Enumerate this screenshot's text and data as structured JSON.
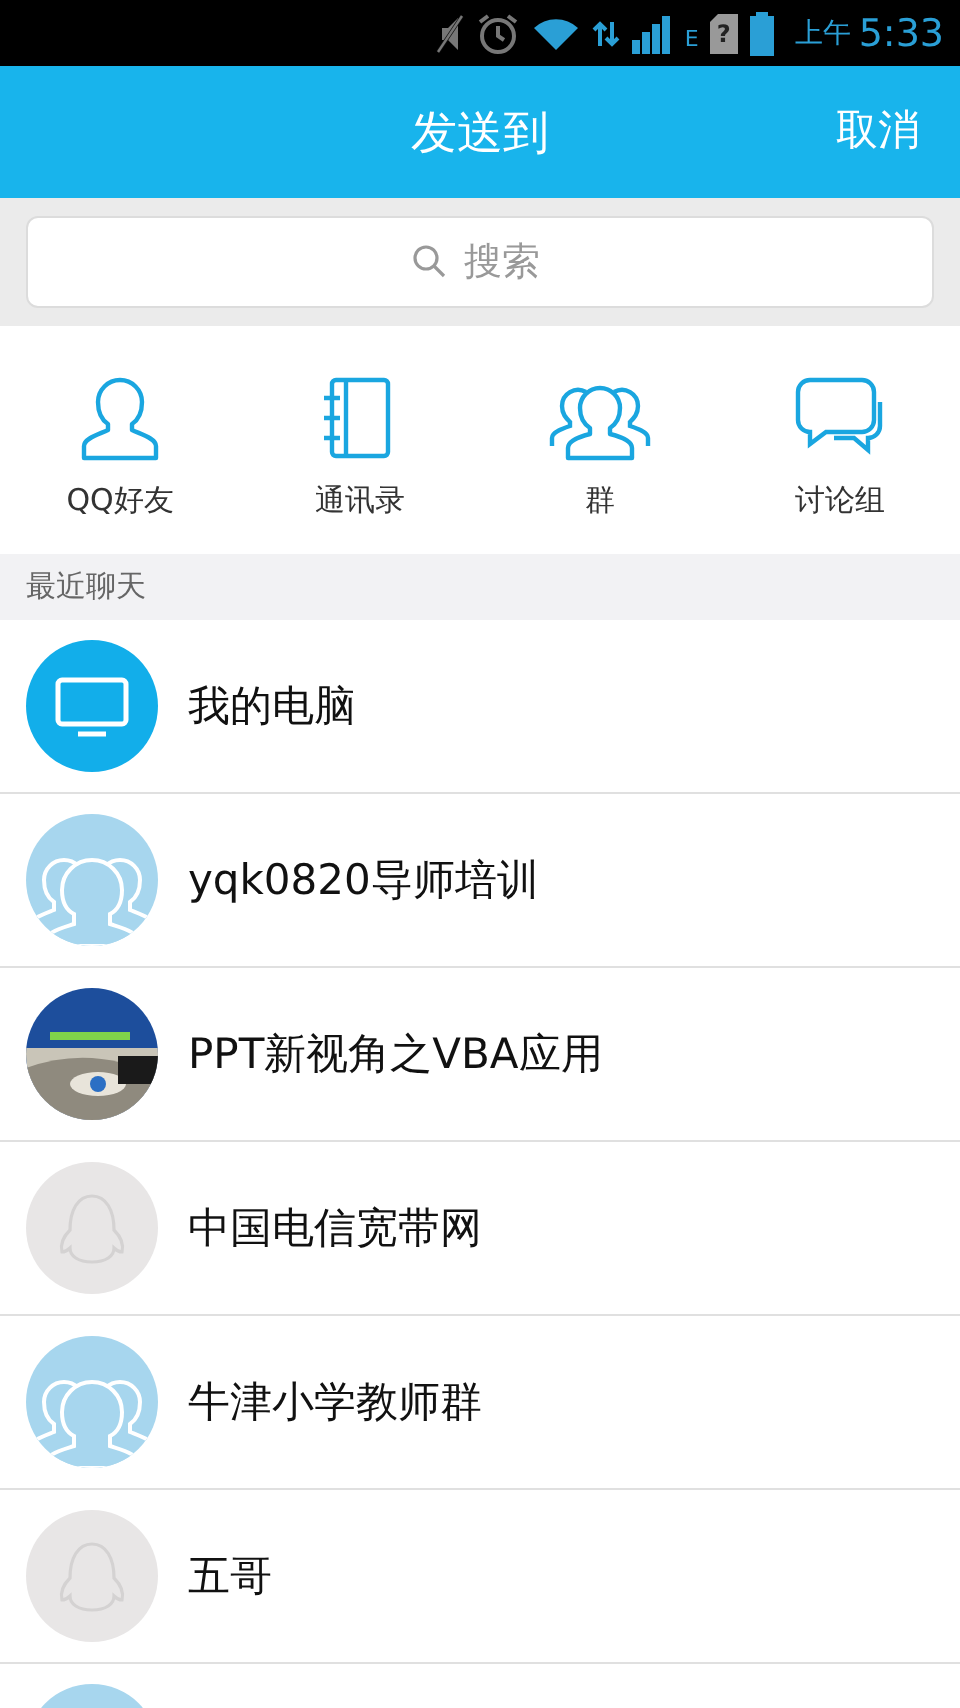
{
  "status_bar": {
    "network_type": "E",
    "sim_mark": "?",
    "time_period": "上午",
    "time": "5:33"
  },
  "header": {
    "title": "发送到",
    "cancel": "取消"
  },
  "search": {
    "placeholder": "搜索"
  },
  "shortcuts": [
    {
      "kind": "friend",
      "label": "QQ好友"
    },
    {
      "kind": "contacts",
      "label": "通讯录"
    },
    {
      "kind": "group",
      "label": "群"
    },
    {
      "kind": "discussion",
      "label": "讨论组"
    }
  ],
  "section": {
    "title": "最近聊天"
  },
  "chats": [
    {
      "kind": "computer",
      "name": "我的电脑"
    },
    {
      "kind": "group",
      "name": "yqk0820导师培训"
    },
    {
      "kind": "picture",
      "name": "PPT新视角之VBA应用"
    },
    {
      "kind": "default",
      "name": "中国电信宽带网"
    },
    {
      "kind": "group",
      "name": "牛津小学教师群"
    },
    {
      "kind": "default",
      "name": "五哥"
    },
    {
      "kind": "group"
    }
  ]
}
